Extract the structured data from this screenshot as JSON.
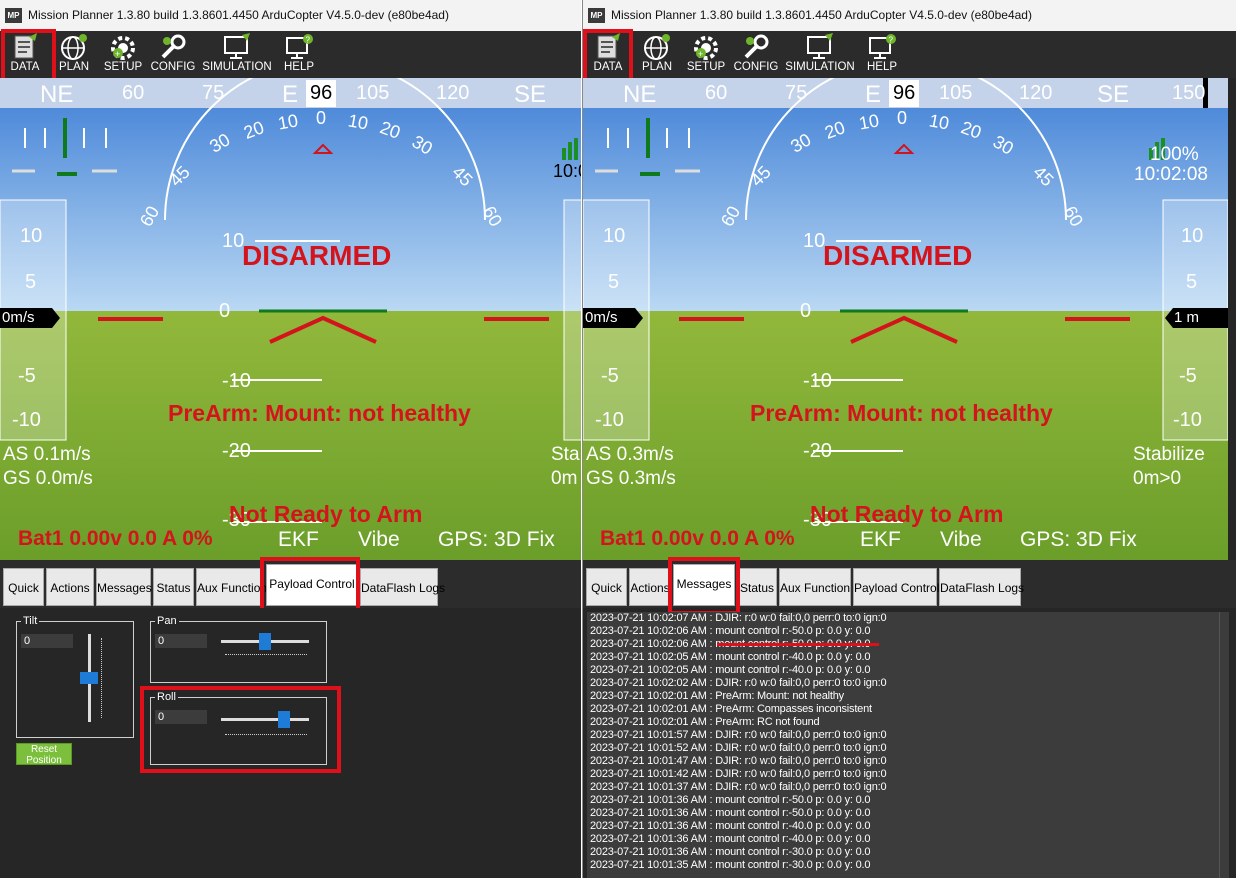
{
  "left": {
    "title": "Mission Planner 1.3.80 build 1.3.8601.4450 ArduCopter V4.5.0-dev (e80be4ad)",
    "logo": "MP",
    "menu": [
      "DATA",
      "PLAN",
      "SETUP",
      "CONFIG",
      "SIMULATION",
      "HELP"
    ],
    "heading": [
      "NE",
      "60",
      "75",
      "E",
      "96",
      "105",
      "120",
      "SE"
    ],
    "pitch": [
      "10",
      "0",
      "-10",
      "-20",
      "-30"
    ],
    "roll_scale": [
      "60",
      "45",
      "30",
      "20",
      "10",
      "0",
      "10",
      "20",
      "30",
      "45",
      "60"
    ],
    "alt_scale": [
      "10",
      "5",
      "0",
      "-5",
      "-10"
    ],
    "speed_box": "0m/s",
    "disarmed": "DISARMED",
    "prearm": "PreArm: Mount: not healthy",
    "notready": "Not Ready to Arm",
    "as": "AS 0.1m/s",
    "gs": "GS 0.0m/s",
    "mode_partial": "Sta",
    "alt_partial": "0m",
    "time_partial": "10:0",
    "battery": "Bat1 0.00v 0.0 A 0%",
    "ekf": "EKF",
    "vibe": "Vibe",
    "gps": "GPS: 3D Fix",
    "tabs": [
      "Quick",
      "Actions",
      "Messages",
      "Status",
      "Aux Function",
      "Payload Control",
      "DataFlash Logs"
    ],
    "payload": {
      "tilt_label": "Tilt",
      "tilt_value": "0",
      "tilt_level": 0.5,
      "pan_label": "Pan",
      "pan_value": "0",
      "pan_level": 0.5,
      "roll_label": "Roll",
      "roll_value": "0",
      "roll_level": 0.75,
      "reset": [
        "Reset",
        "Position"
      ]
    }
  },
  "right": {
    "title": "Mission Planner 1.3.80 build 1.3.8601.4450 ArduCopter V4.5.0-dev (e80be4ad)",
    "logo": "MP",
    "menu": [
      "DATA",
      "PLAN",
      "SETUP",
      "CONFIG",
      "SIMULATION",
      "HELP"
    ],
    "heading": [
      "NE",
      "60",
      "75",
      "E",
      "96",
      "105",
      "120",
      "SE",
      "150"
    ],
    "pitch": [
      "10",
      "0",
      "-10",
      "-20",
      "-30"
    ],
    "roll_scale": [
      "60",
      "45",
      "30",
      "20",
      "10",
      "0",
      "10",
      "20",
      "30",
      "45",
      "60"
    ],
    "alt_scale": [
      "10",
      "5",
      "0",
      "-5",
      "-10"
    ],
    "speed_box": "0m/s",
    "alt_box": "1 m",
    "signal": "100%",
    "time": "10:02:08",
    "disarmed": "DISARMED",
    "prearm": "PreArm: Mount: not healthy",
    "notready": "Not Ready to Arm",
    "as": "AS 0.3m/s",
    "gs": "GS 0.3m/s",
    "mode": "Stabilize",
    "alt_text": "0m>0",
    "battery": "Bat1 0.00v 0.0 A 0%",
    "ekf": "EKF",
    "vibe": "Vibe",
    "gps": "GPS: 3D Fix",
    "tabs": [
      "Quick",
      "Actions",
      "Messages",
      "Status",
      "Aux Function",
      "Payload Control",
      "DataFlash Logs"
    ],
    "messages": [
      "2023-07-21 10:02:07 AM : DJIR: r:0 w:0 fail:0,0 perr:0 to:0 ign:0",
      "2023-07-21 10:02:06 AM : mount control r:-50.0 p: 0.0 y: 0.0",
      "2023-07-21 10:02:06 AM : mount control r:-50.0 p: 0.0 y: 0.0",
      "2023-07-21 10:02:05 AM : mount control r:-40.0 p: 0.0 y: 0.0",
      "2023-07-21 10:02:05 AM : mount control r:-40.0 p: 0.0 y: 0.0",
      "2023-07-21 10:02:02 AM : DJIR: r:0 w:0 fail:0,0 perr:0 to:0 ign:0",
      "2023-07-21 10:02:01 AM : PreArm: Mount: not healthy",
      "2023-07-21 10:02:01 AM : PreArm: Compasses inconsistent",
      "2023-07-21 10:02:01 AM : PreArm: RC not found",
      "2023-07-21 10:01:57 AM : DJIR: r:0 w:0 fail:0,0 perr:0 to:0 ign:0",
      "2023-07-21 10:01:52 AM : DJIR: r:0 w:0 fail:0,0 perr:0 to:0 ign:0",
      "2023-07-21 10:01:47 AM : DJIR: r:0 w:0 fail:0,0 perr:0 to:0 ign:0",
      "2023-07-21 10:01:42 AM : DJIR: r:0 w:0 fail:0,0 perr:0 to:0 ign:0",
      "2023-07-21 10:01:37 AM : DJIR: r:0 w:0 fail:0,0 perr:0 to:0 ign:0",
      "2023-07-21 10:01:36 AM : mount control r:-50.0 p: 0.0 y: 0.0",
      "2023-07-21 10:01:36 AM : mount control r:-50.0 p: 0.0 y: 0.0",
      "2023-07-21 10:01:36 AM : mount control r:-40.0 p: 0.0 y: 0.0",
      "2023-07-21 10:01:36 AM : mount control r:-40.0 p: 0.0 y: 0.0",
      "2023-07-21 10:01:36 AM : mount control r:-30.0 p: 0.0 y: 0.0",
      "2023-07-21 10:01:35 AM : mount control r:-30.0 p: 0.0 y: 0.0"
    ]
  },
  "colors": {
    "hud_red": "#d3141c",
    "highlight": "#e0101a",
    "horizon_green": "#0e7a1c",
    "sky": "#3f7fd6",
    "ground": "#8fb340"
  }
}
